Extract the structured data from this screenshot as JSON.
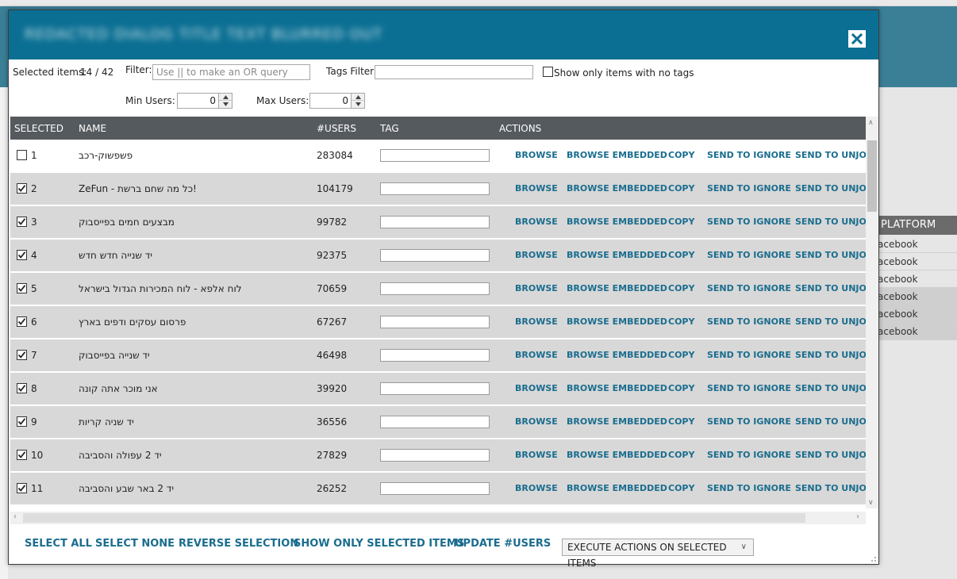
{
  "background": {
    "table_header": "PLATFORM",
    "cells": [
      "acebook",
      "acebook",
      "acebook",
      "acebook",
      "acebook",
      "acebook"
    ]
  },
  "dialog": {
    "title": "REDACTED DIALOG TITLE TEXT BLURRED OUT",
    "selected_items_label": "Selected items:",
    "selected_items_value": "14 / 42",
    "filter_label": "Filter:",
    "filter_placeholder": "Use || to make an OR query",
    "tags_filter_label": "Tags Filter:",
    "tags_filter_value": "",
    "no_tags_label": "Show only items with no tags",
    "min_users_label": "Min Users:",
    "min_users_value": "0",
    "max_users_label": "Max Users:",
    "max_users_value": "0"
  },
  "grid": {
    "columns": [
      "SELECTED",
      "NAME",
      "#USERS",
      "TAG",
      "ACTIONS"
    ],
    "actions": [
      "BROWSE",
      "BROWSE EMBEDDED",
      "COPY",
      "SEND TO IGNORE",
      "SEND TO UNJOIN"
    ],
    "rows": [
      {
        "num": "1",
        "name": "פשפשוק-רכב",
        "users": "283084",
        "checked": false
      },
      {
        "num": "2",
        "name": "ZeFun - כל מה שחם ברשת!",
        "users": "104179",
        "checked": true
      },
      {
        "num": "3",
        "name": "מבצעים חמים בפייסבוק",
        "users": "99782",
        "checked": true
      },
      {
        "num": "4",
        "name": "יד שנייה חדש חדש",
        "users": "92375",
        "checked": true
      },
      {
        "num": "5",
        "name": "לוח אלפא - לוח המכירות הגדול בישראל",
        "users": "70659",
        "checked": true
      },
      {
        "num": "6",
        "name": "פרסום עסקים ודפים בארץ",
        "users": "67267",
        "checked": true
      },
      {
        "num": "7",
        "name": "יד שנייה בפייסבוק",
        "users": "46498",
        "checked": true
      },
      {
        "num": "8",
        "name": "אני מוכר אתה קונה",
        "users": "39920",
        "checked": true
      },
      {
        "num": "9",
        "name": "יד שניה קריות",
        "users": "36556",
        "checked": true
      },
      {
        "num": "10",
        "name": "יד 2 עפולה והסביבה",
        "users": "27829",
        "checked": true
      },
      {
        "num": "11",
        "name": "יד 2 באר שבע והסביבה",
        "users": "26252",
        "checked": true
      }
    ]
  },
  "footer": {
    "select_all": "SELECT ALL",
    "select_none": "SELECT NONE",
    "reverse_selection": "REVERSE SELECTION",
    "show_only_selected": "SHOW ONLY SELECTED ITEMS",
    "update_users": "UPDATE #USERS",
    "execute_actions": "EXECUTE ACTIONS ON SELECTED ITEMS"
  },
  "colors": {
    "header": "#0b6f93",
    "link": "#1a6d8e",
    "grid_header": "#555a5e"
  }
}
